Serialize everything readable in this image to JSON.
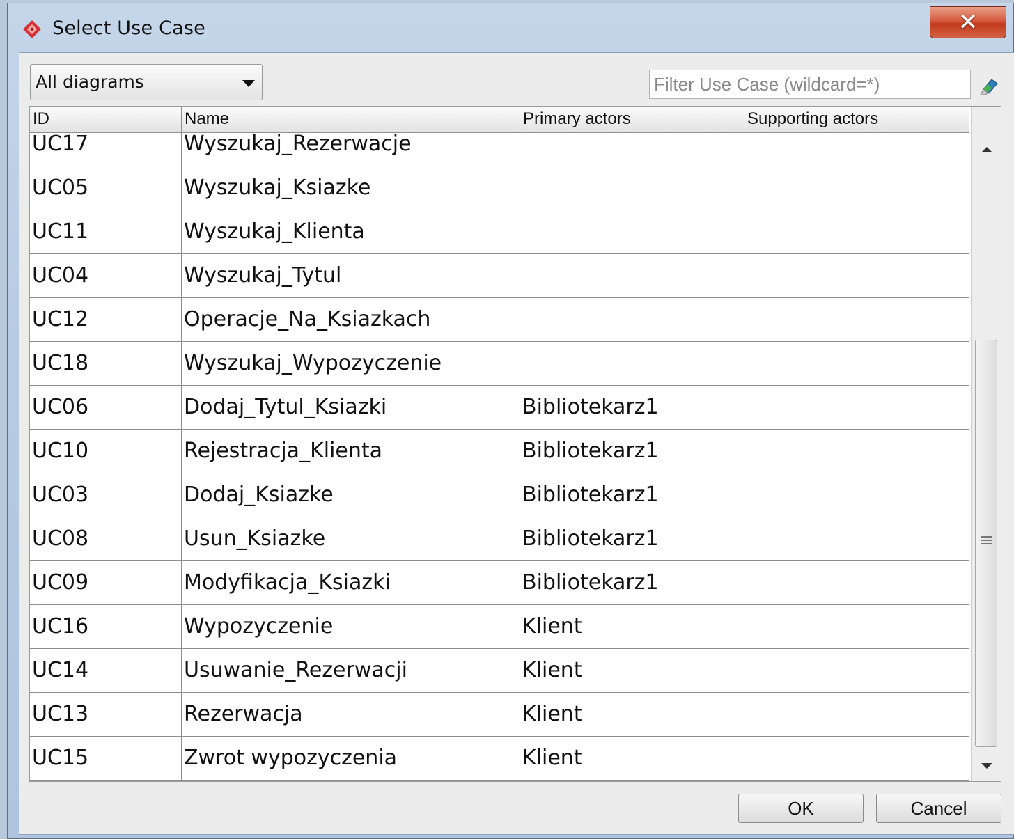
{
  "window": {
    "title": "Select Use Case",
    "close_glyph": "✕"
  },
  "toolbar": {
    "diagram_filter": "All diagrams",
    "filter_placeholder": "Filter Use Case (wildcard=*)",
    "filter_icon": "eraser-icon"
  },
  "table": {
    "columns": [
      "ID",
      "Name",
      "Primary actors",
      "Supporting actors"
    ],
    "rows": [
      {
        "id": "UC17",
        "name": "Wyszukaj_Rezerwacje",
        "primary": "",
        "supporting": ""
      },
      {
        "id": "UC05",
        "name": "Wyszukaj_Ksiazke",
        "primary": "",
        "supporting": ""
      },
      {
        "id": "UC11",
        "name": "Wyszukaj_Klienta",
        "primary": "",
        "supporting": ""
      },
      {
        "id": "UC04",
        "name": "Wyszukaj_Tytul",
        "primary": "",
        "supporting": ""
      },
      {
        "id": "UC12",
        "name": "Operacje_Na_Ksiazkach",
        "primary": "",
        "supporting": ""
      },
      {
        "id": "UC18",
        "name": "Wyszukaj_Wypozyczenie",
        "primary": "",
        "supporting": ""
      },
      {
        "id": "UC06",
        "name": "Dodaj_Tytul_Ksiazki",
        "primary": "Bibliotekarz1",
        "supporting": ""
      },
      {
        "id": "UC10",
        "name": "Rejestracja_Klienta",
        "primary": "Bibliotekarz1",
        "supporting": ""
      },
      {
        "id": "UC03",
        "name": "Dodaj_Ksiazke",
        "primary": "Bibliotekarz1",
        "supporting": ""
      },
      {
        "id": "UC08",
        "name": "Usun_Ksiazke",
        "primary": "Bibliotekarz1",
        "supporting": ""
      },
      {
        "id": "UC09",
        "name": "Modyfikacja_Ksiazki",
        "primary": "Bibliotekarz1",
        "supporting": ""
      },
      {
        "id": "UC16",
        "name": "Wypozyczenie",
        "primary": "Klient",
        "supporting": ""
      },
      {
        "id": "UC14",
        "name": "Usuwanie_Rezerwacji",
        "primary": "Klient",
        "supporting": ""
      },
      {
        "id": "UC13",
        "name": "Rezerwacja",
        "primary": "Klient",
        "supporting": ""
      },
      {
        "id": "UC15",
        "name": "Zwrot wypozyczenia",
        "primary": "Klient",
        "supporting": ""
      }
    ]
  },
  "buttons": {
    "ok": "OK",
    "cancel": "Cancel"
  },
  "colors": {
    "accent_icon": "#d7303a",
    "close_button": "#c2391c"
  }
}
